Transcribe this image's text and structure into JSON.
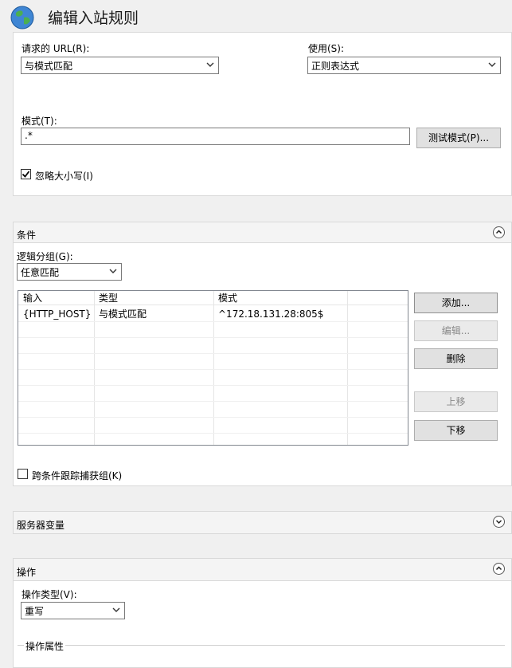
{
  "window": {
    "title": "编辑入站规则"
  },
  "match_url": {
    "requested_url_label": "请求的 URL(R):",
    "requested_url_value": "与模式匹配",
    "using_label": "使用(S):",
    "using_value": "正则表达式",
    "pattern_label": "模式(T):",
    "pattern_value": ".*",
    "test_pattern_button": "测试模式(P)...",
    "ignore_case_label": "忽略大小写(I)",
    "ignore_case_checked": true
  },
  "conditions": {
    "section_title": "条件",
    "logical_grouping_label": "逻辑分组(G):",
    "logical_grouping_value": "任意匹配",
    "columns": [
      "输入",
      "类型",
      "模式"
    ],
    "rows": [
      {
        "input": "{HTTP_HOST}",
        "type": "与模式匹配",
        "pattern": "^172.18.131.28:805$"
      }
    ],
    "buttons": {
      "add": "添加...",
      "edit": "编辑...",
      "remove": "删除",
      "move_up": "上移",
      "move_down": "下移"
    },
    "track_groups_label": "跨条件跟踪捕获组(K)",
    "track_groups_checked": false
  },
  "server_variables": {
    "section_title": "服务器变量"
  },
  "action": {
    "section_title": "操作",
    "action_type_label": "操作类型(V):",
    "action_type_value": "重写",
    "action_properties_label": "操作属性"
  },
  "colors": {
    "panel_border": "#d9d9d9",
    "background": "#f0f0f0"
  }
}
